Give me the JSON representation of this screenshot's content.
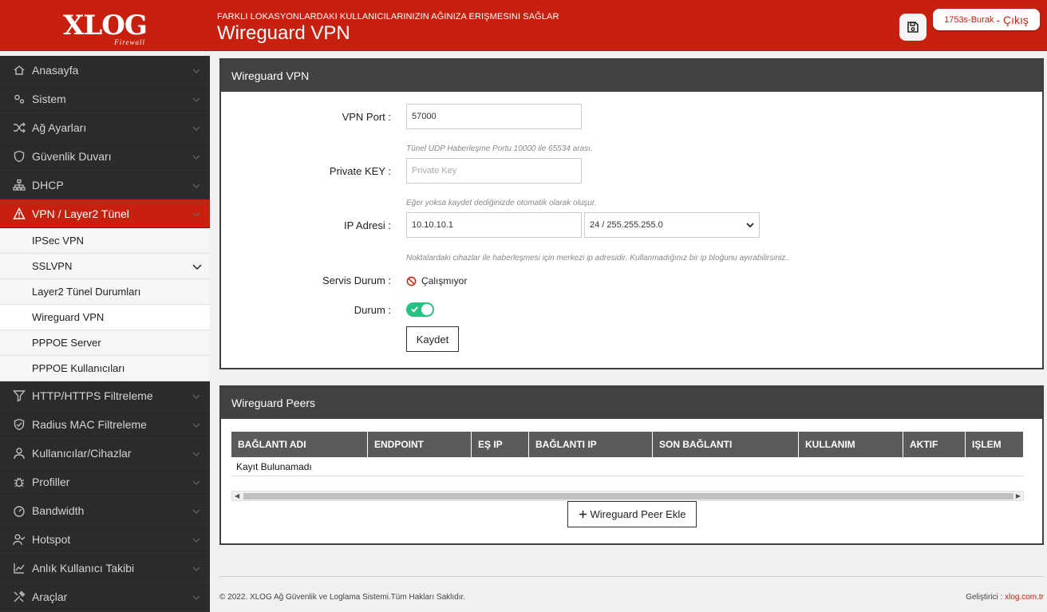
{
  "header": {
    "logo_text": "XLOG",
    "logo_sub": "Firewall",
    "subtitle": "FARKLI LOKASYONLARDAKI KULLANICILARINIZIN AĞINIZA ERIŞMESINI SAĞLAR",
    "title": "Wireguard VPN",
    "user": "1753s-Burak",
    "logout": "- Çıkış"
  },
  "sidebar": {
    "items_top": [
      {
        "label": "Anasayfa",
        "icon": "home-icon"
      },
      {
        "label": "Sistem",
        "icon": "gears-icon"
      },
      {
        "label": "Ağ Ayarları",
        "icon": "shuffle-icon"
      },
      {
        "label": "Güvenlik Duvarı",
        "icon": "shield-icon"
      },
      {
        "label": "DHCP",
        "icon": "sitemap-icon"
      },
      {
        "label": "VPN / Layer2 Tünel",
        "icon": "warning-icon"
      }
    ],
    "sub_items": [
      {
        "label": "IPSec VPN"
      },
      {
        "label": "SSLVPN"
      },
      {
        "label": "Layer2 Tünel Durumları"
      },
      {
        "label": "Wireguard VPN"
      },
      {
        "label": "PPPOE Server"
      },
      {
        "label": "PPPOE Kullanıcıları"
      }
    ],
    "items_bottom": [
      {
        "label": "HTTP/HTTPS Filtreleme",
        "icon": "filter-icon"
      },
      {
        "label": "Radius MAC Filtreleme",
        "icon": "shield-check-icon"
      },
      {
        "label": "Kullanıcılar/Cihazlar",
        "icon": "user-icon"
      },
      {
        "label": "Profiller",
        "icon": "bug-icon"
      },
      {
        "label": "Bandwidth",
        "icon": "gauge-icon"
      },
      {
        "label": "Hotspot",
        "icon": "user-check-icon"
      },
      {
        "label": "Anlık Kullanıcı Takibi",
        "icon": "chart-line-icon"
      },
      {
        "label": "Araçlar",
        "icon": "tools-icon"
      }
    ]
  },
  "vpn": {
    "card_title": "Wireguard VPN",
    "port_label": "VPN Port :",
    "port_value": "57000",
    "port_hint": "Tünel UDP Haberleşme Portu 10000 ile 65534 arası.",
    "key_label": "Private KEY :",
    "key_placeholder": "Private Key",
    "key_hint": "Eğer yoksa kaydet dediğinizde otomatik olarak oluşur.",
    "ip_label": "IP Adresi :",
    "ip_value": "10.10.10.1",
    "mask_value": "24 / 255.255.255.0",
    "ip_hint": "Noktalardaki cihazlar ile haberleşmesi için merkezi ip adresidir. Kullanmadığınız bir ip bloğunu ayırabilirsiniz..",
    "service_label": "Servis Durum :",
    "service_value": "Çalışmıyor",
    "status_label": "Durum :",
    "save_label": "Kaydet"
  },
  "peers": {
    "card_title": "Wireguard Peers",
    "columns": [
      "BAĞLANTI ADI",
      "ENDPOINT",
      "EŞ IP",
      "BAĞLANTI IP",
      "SON BAĞLANTI",
      "KULLANIM",
      "AKTIF",
      "IŞLEM"
    ],
    "empty": "Kayıt Bulunamadı",
    "add_label": "Wireguard Peer Ekle"
  },
  "footer": {
    "copyright": "© 2022. XLOG Ağ Güvenlik ve Loglama Sistemi.Tüm Hakları Saklıdır.",
    "dev_label": "Geliştirici :",
    "dev_link": "xlog.com.tr"
  },
  "colors": {
    "accent": "#c8200f",
    "sidebar": "#2b2b2b",
    "toggle_on": "#26c281"
  }
}
